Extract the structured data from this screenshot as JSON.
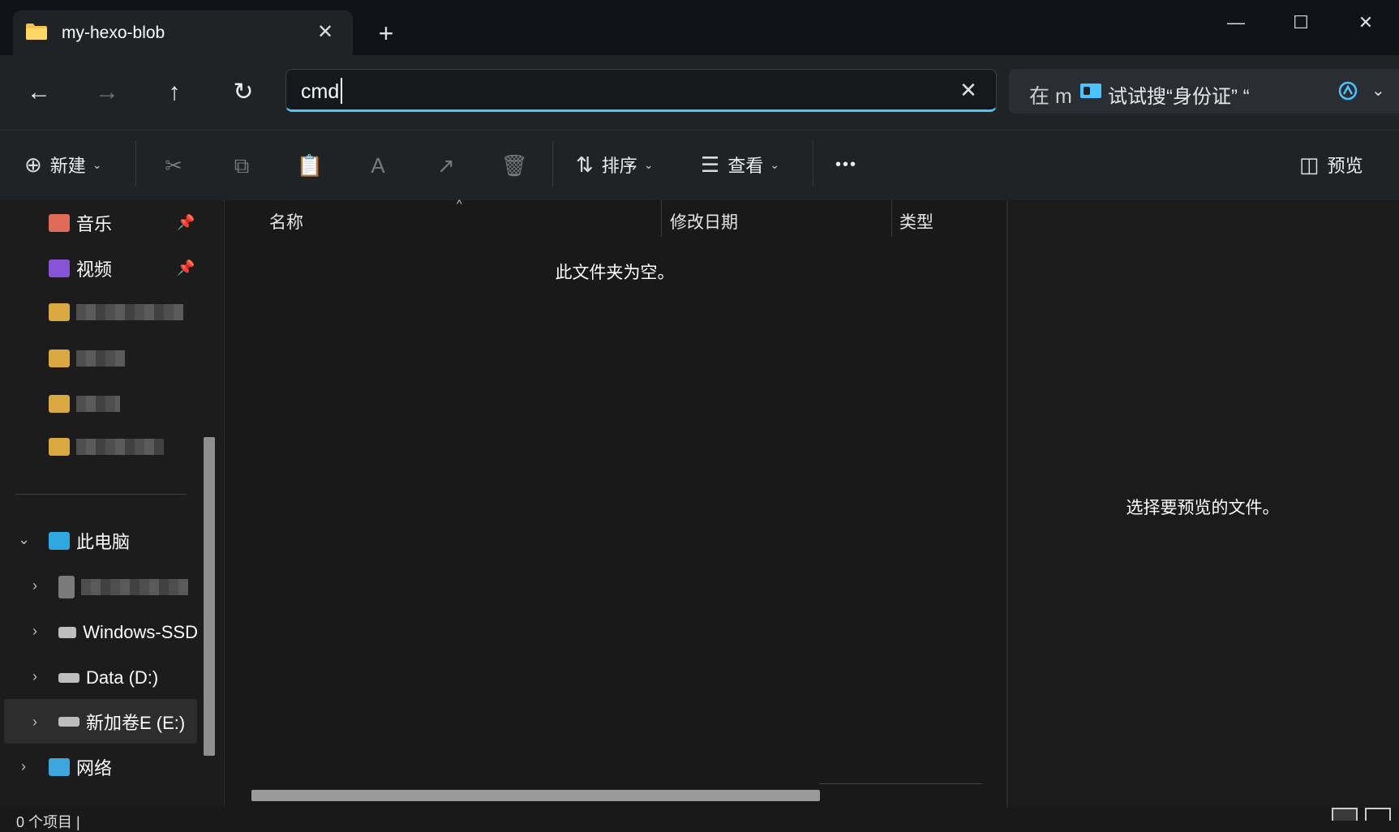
{
  "window": {
    "tab_title": "my-hexo-blob",
    "tab_close": "✕",
    "new_tab": "+",
    "minimize": "—",
    "maximize": "☐",
    "close": "✕"
  },
  "nav": {
    "back": "←",
    "forward": "→",
    "up": "↑",
    "refresh": "↻",
    "address_value": "cmd",
    "address_clear": "✕"
  },
  "search": {
    "prefix": "在 m",
    "hint": "试试搜“身份证” “",
    "copilot_icon": "copilot-icon",
    "chevron": "⌄"
  },
  "toolbar": {
    "new_label": "新建",
    "sort_label": "排序",
    "view_label": "查看",
    "more": "•••",
    "preview_label": "预览",
    "new_icon": "⊕",
    "sort_icon": "⇅",
    "view_icon": "☰",
    "preview_icon": "◫",
    "cut_icon": "✂",
    "copy_icon": "⧉",
    "paste_icon": "📋",
    "rename_icon": "A",
    "share_icon": "↗",
    "delete_icon": "🗑",
    "dropdown": "⌄"
  },
  "sidebar": {
    "music": "音乐",
    "videos": "视频",
    "this_pc": "此电脑",
    "windows_ssd": "Windows-SSD",
    "data_d": "Data (D:)",
    "new_vol_e": "新加卷E (E:)",
    "network": "网络",
    "pin": "📌",
    "expand": "›",
    "collapse": "⌄"
  },
  "columns": {
    "name": "名称",
    "modified": "修改日期",
    "type": "类型",
    "sort_arrow": "^"
  },
  "content": {
    "empty_message": "此文件夹为空。"
  },
  "preview": {
    "message": "选择要预览的文件。"
  },
  "status": {
    "text": "0 个项目 |"
  }
}
